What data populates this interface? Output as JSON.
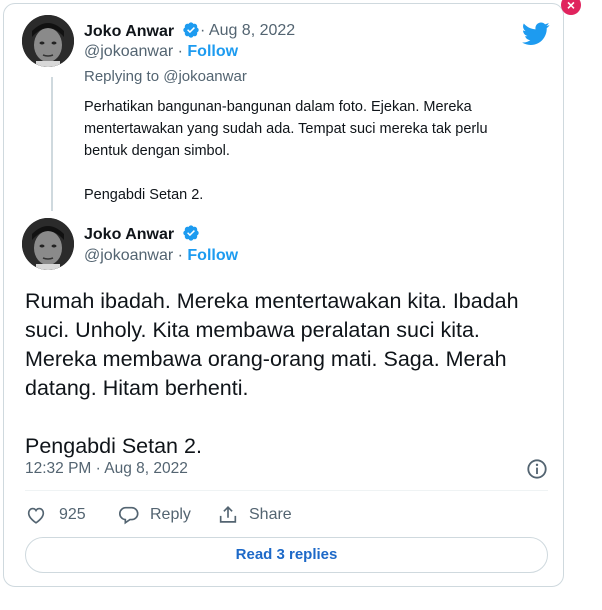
{
  "colors": {
    "accent": "#1d9bf0",
    "muted": "#536471",
    "border": "#cfd9de",
    "close_badge": "#e0245e"
  },
  "close_badge": {
    "icon": "close-icon",
    "glyph": "×"
  },
  "logo": {
    "icon": "twitter-bird-icon"
  },
  "parent_tweet": {
    "name": "Joko Anwar",
    "date": "· Aug 8, 2022",
    "handle": "@jokoanwar",
    "separator": "·",
    "follow_label": "Follow",
    "replying_prefix": "Replying to",
    "replying_mention": "@jokoanwar",
    "text_paragraph_1": "Perhatikan bangunan-bangunan dalam foto. Ejekan. Mereka mentertawakan yang sudah ada. Tempat suci mereka tak perlu bentuk dengan simbol.",
    "text_paragraph_2": "Pengabdi Setan 2."
  },
  "main_tweet": {
    "name": "Joko Anwar",
    "handle": "@jokoanwar",
    "separator": "·",
    "follow_label": "Follow",
    "text_paragraph_1": "Rumah ibadah. Mereka mentertawakan kita. Ibadah suci. Unholy. Kita membawa peralatan suci kita. Mereka membawa orang-orang mati. Saga. Merah datang. Hitam berhenti.",
    "text_paragraph_2": "Pengabdi Setan 2.",
    "timestamp": "12:32 PM · Aug 8, 2022"
  },
  "actions": {
    "like_count": "925",
    "reply_label": "Reply",
    "share_label": "Share"
  },
  "read_replies_label": "Read 3 replies"
}
